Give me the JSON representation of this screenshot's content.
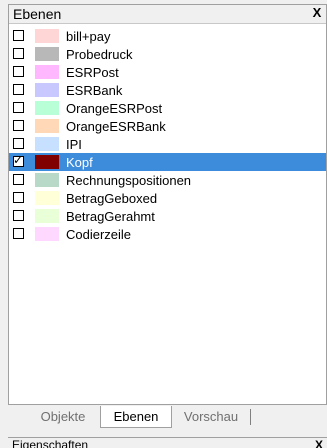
{
  "panel": {
    "title": "Ebenen",
    "close_symbol": "X"
  },
  "layers": [
    {
      "label": "bill+pay",
      "color": "#ffd6d6",
      "checked": false,
      "selected": false
    },
    {
      "label": "Probedruck",
      "color": "#b8b8b8",
      "checked": false,
      "selected": false
    },
    {
      "label": "ESRPost",
      "color": "#ffb8ff",
      "checked": false,
      "selected": false
    },
    {
      "label": "ESRBank",
      "color": "#c8c8ff",
      "checked": false,
      "selected": false
    },
    {
      "label": "OrangeESRPost",
      "color": "#b8ffd8",
      "checked": false,
      "selected": false
    },
    {
      "label": "OrangeESRBank",
      "color": "#ffd8b8",
      "checked": false,
      "selected": false
    },
    {
      "label": "IPI",
      "color": "#c8e0ff",
      "checked": false,
      "selected": false
    },
    {
      "label": "Kopf",
      "color": "#800000",
      "checked": true,
      "selected": true
    },
    {
      "label": "Rechnungspositionen",
      "color": "#b8d8c8",
      "checked": false,
      "selected": false
    },
    {
      "label": "BetragGeboxed",
      "color": "#ffffd8",
      "checked": false,
      "selected": false
    },
    {
      "label": "BetragGerahmt",
      "color": "#e8ffd8",
      "checked": false,
      "selected": false
    },
    {
      "label": "Codierzeile",
      "color": "#ffd8ff",
      "checked": false,
      "selected": false
    }
  ],
  "tabs": [
    {
      "label": "Objekte",
      "active": false
    },
    {
      "label": "Ebenen",
      "active": true
    },
    {
      "label": "Vorschau",
      "active": false
    }
  ],
  "bottom_panel": {
    "title": "Eigenschaften",
    "close_symbol": "X"
  }
}
